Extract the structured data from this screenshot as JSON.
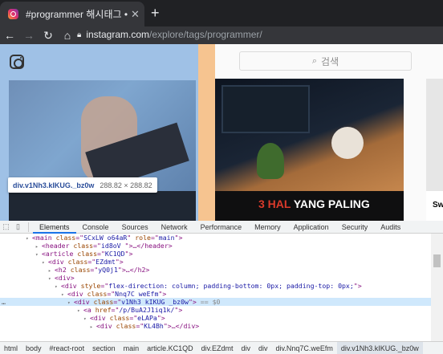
{
  "browser": {
    "tab_title": "#programmer 해시태그 • Instag",
    "new_tab_icon": "plus-icon",
    "url_host": "instagram.com",
    "url_path": "/explore/tags/programmer/"
  },
  "page": {
    "search_placeholder": "검색",
    "tooltip_selector": "div.v1Nh3.kIKUG._bz0w",
    "tooltip_size": "288.82 × 288.82",
    "post_banner_part1": "3 HAL",
    "post_banner_part2": "YANG PALING",
    "edge_label": "Swi",
    "highlight_color": "#9fc1e6",
    "padding_color": "#f6c490"
  },
  "devtools": {
    "tabs": [
      "Elements",
      "Console",
      "Sources",
      "Network",
      "Performance",
      "Memory",
      "Application",
      "Security",
      "Audits"
    ],
    "active_tab": "Elements",
    "tree": [
      {
        "tag": "main",
        "attrs": [
          [
            "class",
            "SCxLW  o64aR"
          ],
          [
            "role",
            "main"
          ]
        ],
        "tail": ""
      },
      {
        "tag": "header",
        "attrs": [
          [
            "class",
            "id8oV "
          ]
        ],
        "tail": "…</header>"
      },
      {
        "tag": "article",
        "attrs": [
          [
            "class",
            "KC1QD"
          ]
        ],
        "tail": ""
      },
      {
        "tag": "div",
        "attrs": [
          [
            "class",
            "EZdmt"
          ]
        ],
        "tail": ""
      },
      {
        "tag": "h2",
        "attrs": [
          [
            "class",
            "yQ0j1"
          ]
        ],
        "tail": "…</h2>"
      },
      {
        "tag": "div",
        "attrs": [],
        "tail": ""
      },
      {
        "tag": "div",
        "attrs": [
          [
            "style",
            "flex-direction: column; padding-bottom: 0px; padding-top: 0px;"
          ]
        ],
        "tail": ""
      },
      {
        "tag": "div",
        "attrs": [
          [
            "class",
            "Nnq7C weEfm"
          ]
        ],
        "tail": ""
      },
      {
        "tag": "div",
        "attrs": [
          [
            "class",
            "v1Nh3 kIKUG  _bz0w"
          ]
        ],
        "tail": " == $0"
      },
      {
        "tag": "a",
        "attrs": [
          [
            "href",
            "/p/BuA2J1iq1k/"
          ]
        ],
        "tail": ""
      },
      {
        "tag": "div",
        "attrs": [
          [
            "class",
            "eLAPa"
          ]
        ],
        "tail": ""
      },
      {
        "tag": "div",
        "attrs": [
          [
            "class",
            "KL4Bh"
          ]
        ],
        "tail": "…</div>"
      }
    ],
    "breadcrumb": [
      "html",
      "body",
      "#react-root",
      "section",
      "main",
      "article.KC1QD",
      "div.EZdmt",
      "div",
      "div",
      "div.Nnq7C.weEfm",
      "div.v1Nh3.kIKUG._bz0w"
    ]
  }
}
